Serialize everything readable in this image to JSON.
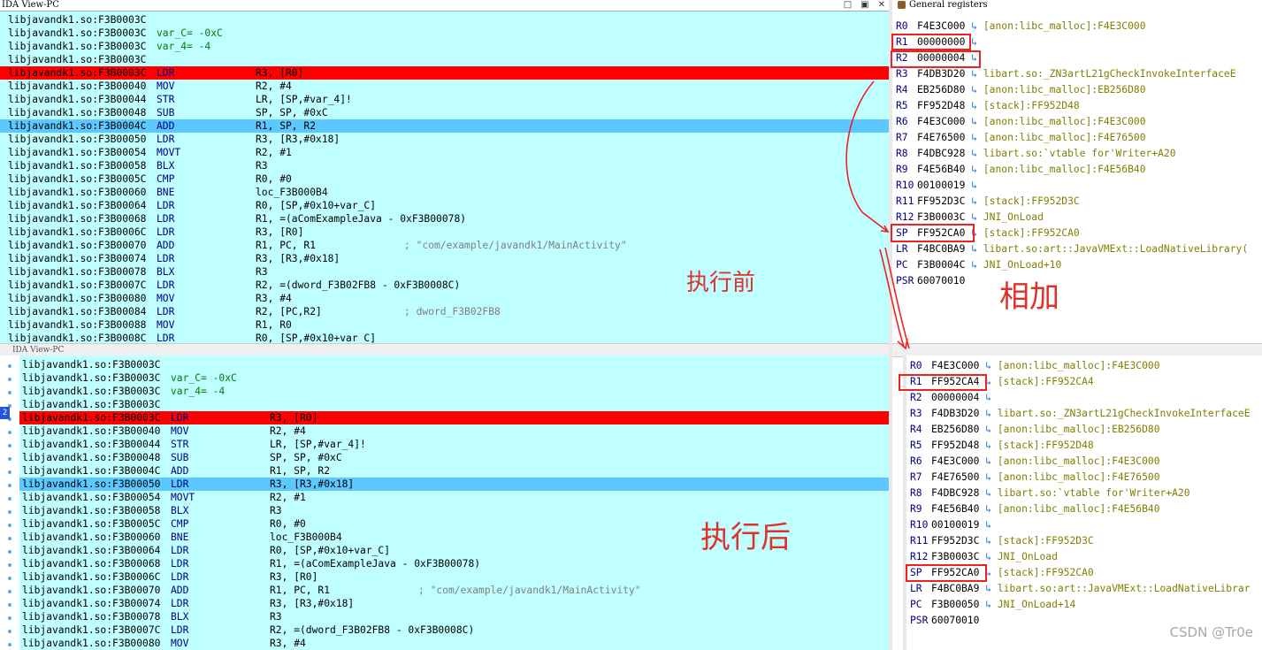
{
  "top_view": {
    "title": "IDA View-PC",
    "window_buttons": [
      "□",
      "▣",
      "✕"
    ],
    "lines": [
      {
        "addr": "libjavandk1.so:F3B0003C",
        "mnem": "",
        "ops": "",
        "def": "",
        "cmt": ""
      },
      {
        "addr": "libjavandk1.so:F3B0003C",
        "mnem": "",
        "ops": "",
        "def": "var_C= -0xC",
        "cmt": ""
      },
      {
        "addr": "libjavandk1.so:F3B0003C",
        "mnem": "",
        "ops": "",
        "def": "var_4= -4",
        "cmt": ""
      },
      {
        "addr": "libjavandk1.so:F3B0003C",
        "mnem": "",
        "ops": "",
        "def": "",
        "cmt": ""
      },
      {
        "addr": "libjavandk1.so:F3B0003C",
        "mnem": "LDR",
        "ops": "R3, [R0]",
        "def": "",
        "cmt": ""
      },
      {
        "addr": "libjavandk1.so:F3B00040",
        "mnem": "MOV",
        "ops": "R2, #4",
        "def": "",
        "cmt": ""
      },
      {
        "addr": "libjavandk1.so:F3B00044",
        "mnem": "STR",
        "ops": "LR, [SP,#var_4]!",
        "def": "",
        "cmt": ""
      },
      {
        "addr": "libjavandk1.so:F3B00048",
        "mnem": "SUB",
        "ops": "SP, SP, #0xC",
        "def": "",
        "cmt": ""
      },
      {
        "addr": "libjavandk1.so:F3B0004C",
        "mnem": "ADD",
        "ops": "R1, SP, R2",
        "def": "",
        "cmt": ""
      },
      {
        "addr": "libjavandk1.so:F3B00050",
        "mnem": "LDR",
        "ops": "R3, [R3,#0x18]",
        "def": "",
        "cmt": ""
      },
      {
        "addr": "libjavandk1.so:F3B00054",
        "mnem": "MOVT",
        "ops": "R2, #1",
        "def": "",
        "cmt": ""
      },
      {
        "addr": "libjavandk1.so:F3B00058",
        "mnem": "BLX",
        "ops": "R3",
        "def": "",
        "cmt": ""
      },
      {
        "addr": "libjavandk1.so:F3B0005C",
        "mnem": "CMP",
        "ops": "R0, #0",
        "def": "",
        "cmt": ""
      },
      {
        "addr": "libjavandk1.so:F3B00060",
        "mnem": "BNE",
        "ops": "loc_F3B000B4",
        "def": "",
        "cmt": ""
      },
      {
        "addr": "libjavandk1.so:F3B00064",
        "mnem": "LDR",
        "ops": "R0, [SP,#0x10+var_C]",
        "def": "",
        "cmt": ""
      },
      {
        "addr": "libjavandk1.so:F3B00068",
        "mnem": "LDR",
        "ops": "R1, =(aComExampleJava - 0xF3B00078)",
        "def": "",
        "cmt": ""
      },
      {
        "addr": "libjavandk1.so:F3B0006C",
        "mnem": "LDR",
        "ops": "R3, [R0]",
        "def": "",
        "cmt": ""
      },
      {
        "addr": "libjavandk1.so:F3B00070",
        "mnem": "ADD",
        "ops": "R1, PC, R1",
        "def": "",
        "cmt": "; \"com/example/javandk1/MainActivity\""
      },
      {
        "addr": "libjavandk1.so:F3B00074",
        "mnem": "LDR",
        "ops": "R3, [R3,#0x18]",
        "def": "",
        "cmt": ""
      },
      {
        "addr": "libjavandk1.so:F3B00078",
        "mnem": "BLX",
        "ops": "R3",
        "def": "",
        "cmt": ""
      },
      {
        "addr": "libjavandk1.so:F3B0007C",
        "mnem": "LDR",
        "ops": "R2, =(dword_F3B02FB8 - 0xF3B0008C)",
        "def": "",
        "cmt": ""
      },
      {
        "addr": "libjavandk1.so:F3B00080",
        "mnem": "MOV",
        "ops": "R3, #4",
        "def": "",
        "cmt": ""
      },
      {
        "addr": "libjavandk1.so:F3B00084",
        "mnem": "LDR",
        "ops": "R2, [PC,R2]",
        "def": "",
        "cmt": "; dword_F3B02FB8"
      },
      {
        "addr": "libjavandk1.so:F3B00088",
        "mnem": "MOV",
        "ops": "R1, R0",
        "def": "",
        "cmt": ""
      },
      {
        "addr": "libjavandk1.so:F3B0008C",
        "mnem": "LDR",
        "ops": "R0, [SP,#0x10+var_C]",
        "def": "",
        "cmt": ""
      }
    ],
    "label": "执行前"
  },
  "bottom_view": {
    "title": "IDA View-PC",
    "lines": [
      {
        "addr": "libjavandk1.so:F3B0003C",
        "mnem": "",
        "ops": "",
        "def": "",
        "cmt": ""
      },
      {
        "addr": "libjavandk1.so:F3B0003C",
        "mnem": "",
        "ops": "",
        "def": "var_C= -0xC",
        "cmt": ""
      },
      {
        "addr": "libjavandk1.so:F3B0003C",
        "mnem": "",
        "ops": "",
        "def": "var_4= -4",
        "cmt": ""
      },
      {
        "addr": "libjavandk1.so:F3B0003C",
        "mnem": "",
        "ops": "",
        "def": "",
        "cmt": ""
      },
      {
        "addr": "libjavandk1.so:F3B0003C",
        "mnem": "LDR",
        "ops": "R3, [R0]",
        "def": "",
        "cmt": ""
      },
      {
        "addr": "libjavandk1.so:F3B00040",
        "mnem": "MOV",
        "ops": "R2, #4",
        "def": "",
        "cmt": ""
      },
      {
        "addr": "libjavandk1.so:F3B00044",
        "mnem": "STR",
        "ops": "LR, [SP,#var_4]!",
        "def": "",
        "cmt": ""
      },
      {
        "addr": "libjavandk1.so:F3B00048",
        "mnem": "SUB",
        "ops": "SP, SP, #0xC",
        "def": "",
        "cmt": ""
      },
      {
        "addr": "libjavandk1.so:F3B0004C",
        "mnem": "ADD",
        "ops": "R1, SP, R2",
        "def": "",
        "cmt": ""
      },
      {
        "addr": "libjavandk1.so:F3B00050",
        "mnem": "LDR",
        "ops": "R3, [R3,#0x18]",
        "def": "",
        "cmt": ""
      },
      {
        "addr": "libjavandk1.so:F3B00054",
        "mnem": "MOVT",
        "ops": "R2, #1",
        "def": "",
        "cmt": ""
      },
      {
        "addr": "libjavandk1.so:F3B00058",
        "mnem": "BLX",
        "ops": "R3",
        "def": "",
        "cmt": ""
      },
      {
        "addr": "libjavandk1.so:F3B0005C",
        "mnem": "CMP",
        "ops": "R0, #0",
        "def": "",
        "cmt": ""
      },
      {
        "addr": "libjavandk1.so:F3B00060",
        "mnem": "BNE",
        "ops": "loc_F3B000B4",
        "def": "",
        "cmt": ""
      },
      {
        "addr": "libjavandk1.so:F3B00064",
        "mnem": "LDR",
        "ops": "R0, [SP,#0x10+var_C]",
        "def": "",
        "cmt": ""
      },
      {
        "addr": "libjavandk1.so:F3B00068",
        "mnem": "LDR",
        "ops": "R1, =(aComExampleJava - 0xF3B00078)",
        "def": "",
        "cmt": ""
      },
      {
        "addr": "libjavandk1.so:F3B0006C",
        "mnem": "LDR",
        "ops": "R3, [R0]",
        "def": "",
        "cmt": ""
      },
      {
        "addr": "libjavandk1.so:F3B00070",
        "mnem": "ADD",
        "ops": "R1, PC, R1",
        "def": "",
        "cmt": "; \"com/example/javandk1/MainActivity\""
      },
      {
        "addr": "libjavandk1.so:F3B00074",
        "mnem": "LDR",
        "ops": "R3, [R3,#0x18]",
        "def": "",
        "cmt": ""
      },
      {
        "addr": "libjavandk1.so:F3B00078",
        "mnem": "BLX",
        "ops": "R3",
        "def": "",
        "cmt": ""
      },
      {
        "addr": "libjavandk1.so:F3B0007C",
        "mnem": "LDR",
        "ops": "R2, =(dword_F3B02FB8 - 0xF3B0008C)",
        "def": "",
        "cmt": ""
      },
      {
        "addr": "libjavandk1.so:F3B00080",
        "mnem": "MOV",
        "ops": "R3, #4",
        "def": "",
        "cmt": ""
      }
    ],
    "label": "执行后",
    "marker": "2"
  },
  "top_regs": {
    "title": "General registers",
    "regs": [
      {
        "name": "R0",
        "value": "F4E3C000",
        "arrow": "↳",
        "ref": "[anon:libc_malloc]:F4E3C000"
      },
      {
        "name": "R1",
        "value": "00000000",
        "arrow": "↳",
        "ref": ""
      },
      {
        "name": "R2",
        "value": "00000004",
        "arrow": "↳",
        "ref": ""
      },
      {
        "name": "R3",
        "value": "F4DB3D20",
        "arrow": "↳",
        "ref": "libart.so:_ZN3artL21gCheckInvokeInterfaceE"
      },
      {
        "name": "R4",
        "value": "EB256D80",
        "arrow": "↳",
        "ref": "[anon:libc_malloc]:EB256D80"
      },
      {
        "name": "R5",
        "value": "FF952D48",
        "arrow": "↳",
        "ref": "[stack]:FF952D48"
      },
      {
        "name": "R6",
        "value": "F4E3C000",
        "arrow": "↳",
        "ref": "[anon:libc_malloc]:F4E3C000"
      },
      {
        "name": "R7",
        "value": "F4E76500",
        "arrow": "↳",
        "ref": "[anon:libc_malloc]:F4E76500"
      },
      {
        "name": "R8",
        "value": "F4DBC928",
        "arrow": "↳",
        "ref": "libart.so:`vtable for'Writer+A20"
      },
      {
        "name": "R9",
        "value": "F4E56B40",
        "arrow": "↳",
        "ref": "[anon:libc_malloc]:F4E56B40"
      },
      {
        "name": "R10",
        "value": "00100019",
        "arrow": "↳",
        "ref": ""
      },
      {
        "name": "R11",
        "value": "FF952D3C",
        "arrow": "↳",
        "ref": "[stack]:FF952D3C"
      },
      {
        "name": "R12",
        "value": "F3B0003C",
        "arrow": "↳",
        "ref": "JNI_OnLoad"
      },
      {
        "name": "SP",
        "value": "FF952CA0",
        "arrow": "↳",
        "ref": "[stack]:FF952CA0"
      },
      {
        "name": "LR",
        "value": "F4BC0BA9",
        "arrow": "↳",
        "ref": "libart.so:art::JavaVMExt::LoadNativeLibrary("
      },
      {
        "name": "PC",
        "value": "F3B0004C",
        "arrow": "↳",
        "ref": "JNI_OnLoad+10"
      },
      {
        "name": "PSR",
        "value": "60070010",
        "arrow": "",
        "ref": ""
      }
    ],
    "label": "相加"
  },
  "bottom_regs": {
    "title": "General registers",
    "regs": [
      {
        "name": "R0",
        "value": "F4E3C000",
        "arrow": "↳",
        "ref": "[anon:libc_malloc]:F4E3C000"
      },
      {
        "name": "R1",
        "value": "FF952CA4",
        "arrow": "↳",
        "ref": "[stack]:FF952CA4"
      },
      {
        "name": "R2",
        "value": "00000004",
        "arrow": "↳",
        "ref": ""
      },
      {
        "name": "R3",
        "value": "F4DB3D20",
        "arrow": "↳",
        "ref": "libart.so:_ZN3artL21gCheckInvokeInterfaceE"
      },
      {
        "name": "R4",
        "value": "EB256D80",
        "arrow": "↳",
        "ref": "[anon:libc_malloc]:EB256D80"
      },
      {
        "name": "R5",
        "value": "FF952D48",
        "arrow": "↳",
        "ref": "[stack]:FF952D48"
      },
      {
        "name": "R6",
        "value": "F4E3C000",
        "arrow": "↳",
        "ref": "[anon:libc_malloc]:F4E3C000"
      },
      {
        "name": "R7",
        "value": "F4E76500",
        "arrow": "↳",
        "ref": "[anon:libc_malloc]:F4E76500"
      },
      {
        "name": "R8",
        "value": "F4DBC928",
        "arrow": "↳",
        "ref": "libart.so:`vtable for'Writer+A20"
      },
      {
        "name": "R9",
        "value": "F4E56B40",
        "arrow": "↳",
        "ref": "[anon:libc_malloc]:F4E56B40"
      },
      {
        "name": "R10",
        "value": "00100019",
        "arrow": "↳",
        "ref": ""
      },
      {
        "name": "R11",
        "value": "FF952D3C",
        "arrow": "↳",
        "ref": "[stack]:FF952D3C"
      },
      {
        "name": "R12",
        "value": "F3B0003C",
        "arrow": "↳",
        "ref": "JNI_OnLoad"
      },
      {
        "name": "SP",
        "value": "FF952CA0",
        "arrow": "↳",
        "ref": "[stack]:FF952CA0"
      },
      {
        "name": "LR",
        "value": "F4BC0BA9",
        "arrow": "↳",
        "ref": "libart.so:art::JavaVMExt::LoadNativeLibrar"
      },
      {
        "name": "PC",
        "value": "F3B00050",
        "arrow": "↳",
        "ref": "JNI_OnLoad+14"
      },
      {
        "name": "PSR",
        "value": "60070010",
        "arrow": "",
        "ref": ""
      }
    ]
  },
  "watermark": "CSDN @Tr0e",
  "colors": {
    "exec_line": "#ff0000",
    "cursor_line": "#5cc8ff",
    "disasm_bg": "#c0ffff",
    "annotation": "#e0302a"
  }
}
